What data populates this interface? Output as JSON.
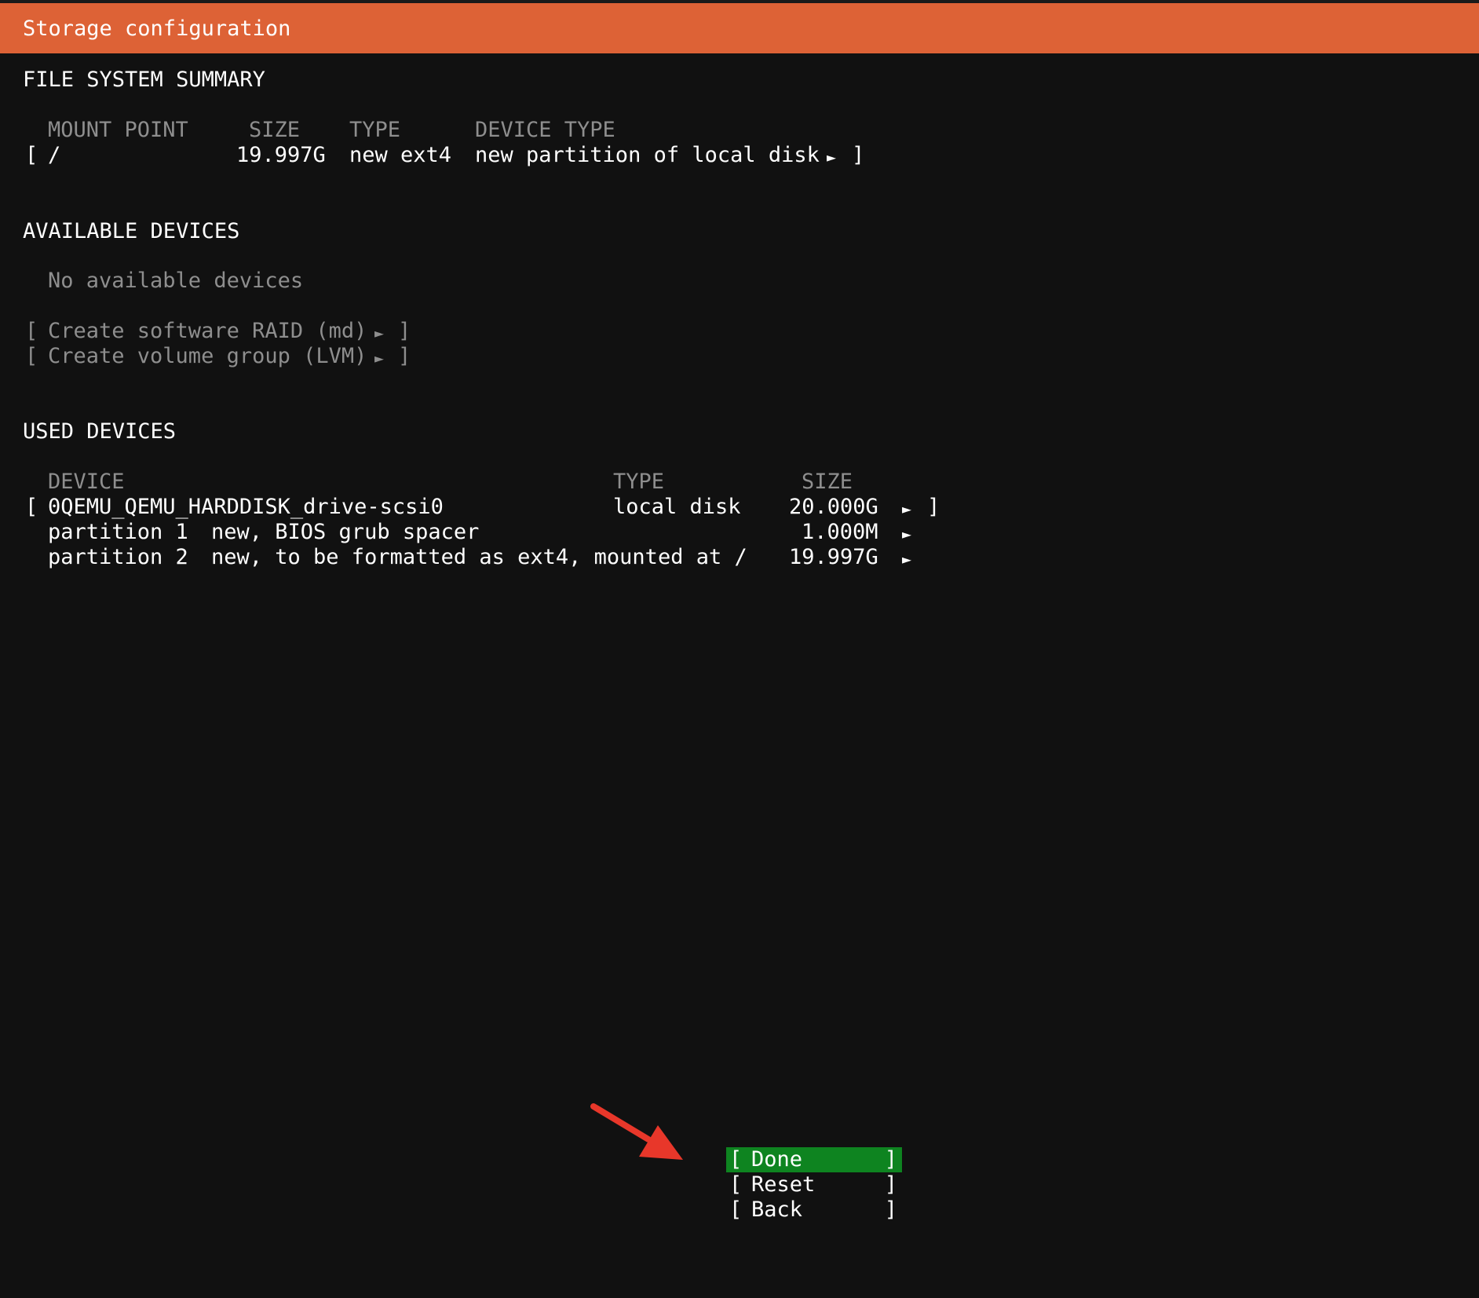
{
  "header": {
    "title": "Storage configuration"
  },
  "fs_summary": {
    "heading": "FILE SYSTEM SUMMARY",
    "columns": {
      "mount_point": "MOUNT POINT",
      "size": "SIZE",
      "type": "TYPE",
      "device_type": "DEVICE TYPE"
    },
    "row": {
      "open_bracket": "[",
      "mount_point": "/",
      "size": "19.997G",
      "type": "new ext4",
      "device_type": "new partition of local disk",
      "arrow": "►",
      "close_bracket": "]"
    }
  },
  "available": {
    "heading": "AVAILABLE DEVICES",
    "empty_text": "No available devices",
    "actions": [
      {
        "open": "[",
        "label": "Create software RAID (md)",
        "arrow": "►",
        "close": "]"
      },
      {
        "open": "[",
        "label": "Create volume group (LVM)",
        "arrow": "►",
        "close": "]"
      }
    ]
  },
  "used": {
    "heading": "USED DEVICES",
    "columns": {
      "device": "DEVICE",
      "type": "TYPE",
      "size": "SIZE"
    },
    "disk": {
      "open_bracket": "[",
      "name": "0QEMU_QEMU_HARDDISK_drive-scsi0",
      "type": "local disk",
      "size": "20.000G",
      "arrow": "►",
      "close_bracket": "]"
    },
    "partitions": [
      {
        "name": "partition 1",
        "desc": "new, BIOS grub spacer",
        "size": "1.000M",
        "arrow": "►"
      },
      {
        "name": "partition 2",
        "desc": "new, to be formatted as ext4, mounted at /",
        "size": "19.997G",
        "arrow": "►"
      }
    ]
  },
  "buttons": [
    {
      "open": "[",
      "label": "Done",
      "close": "]"
    },
    {
      "open": "[",
      "label": "Reset",
      "close": "]"
    },
    {
      "open": "[",
      "label": "Back",
      "close": "]"
    }
  ],
  "colors": {
    "header_bg": "#dd6236",
    "background": "#111111",
    "active_button": "#0e8420",
    "dim_text": "#8e8e8e",
    "annotation_arrow": "#e8372a"
  }
}
